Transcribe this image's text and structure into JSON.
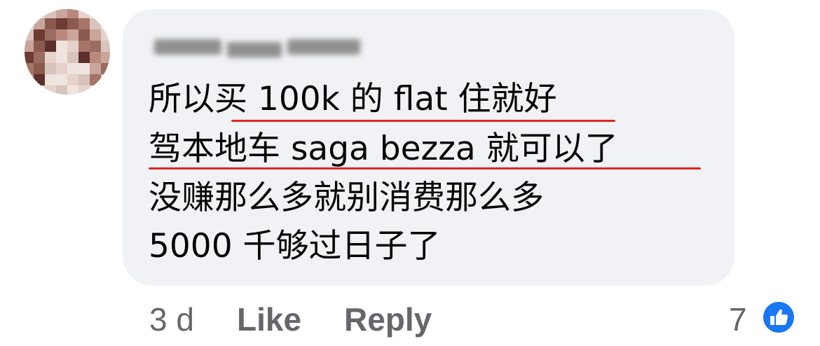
{
  "comment": {
    "lines": [
      "所以买 100k 的 flat 住就好",
      "驾本地车 saga bezza 就可以了",
      "没赚那么多就别消费那么多",
      "5000 千够过日子了"
    ]
  },
  "actions": {
    "timestamp": "3 d",
    "like_label": "Like",
    "reply_label": "Reply"
  },
  "reactions": {
    "count": "7",
    "icon": "thumbs-up-icon",
    "badge_color": "#1877f2"
  },
  "colors": {
    "bubble": "#f0f2f5",
    "underline": "#e02424",
    "muted_text": "#65676b"
  }
}
